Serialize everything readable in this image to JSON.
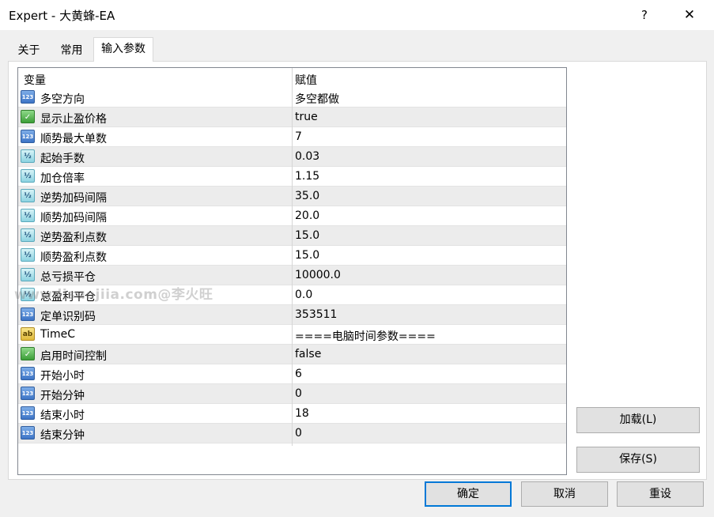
{
  "window": {
    "title": "Expert - 大黄蜂-EA",
    "help": "?",
    "close": "✕"
  },
  "tabs": [
    {
      "label": "关于"
    },
    {
      "label": "常用"
    },
    {
      "label": "输入参数"
    }
  ],
  "grid": {
    "headers": {
      "variable": "变量",
      "value": "赋值"
    },
    "rows": [
      {
        "type": "int",
        "icon": "123",
        "name": "多空方向",
        "value": "多空都做"
      },
      {
        "type": "bool",
        "icon": "✓",
        "name": "显示止盈价格",
        "value": "true"
      },
      {
        "type": "int",
        "icon": "123",
        "name": "顺势最大单数",
        "value": "7"
      },
      {
        "type": "dbl",
        "icon": "½",
        "name": "起始手数",
        "value": "0.03"
      },
      {
        "type": "dbl",
        "icon": "½",
        "name": "加仓倍率",
        "value": "1.15"
      },
      {
        "type": "dbl",
        "icon": "½",
        "name": "逆势加码间隔",
        "value": "35.0"
      },
      {
        "type": "dbl",
        "icon": "½",
        "name": "顺势加码间隔",
        "value": "20.0"
      },
      {
        "type": "dbl",
        "icon": "½",
        "name": "逆势盈利点数",
        "value": "15.0"
      },
      {
        "type": "dbl",
        "icon": "½",
        "name": "顺势盈利点数",
        "value": "15.0"
      },
      {
        "type": "dbl",
        "icon": "½",
        "name": "总亏损平仓",
        "value": "10000.0"
      },
      {
        "type": "dbl",
        "icon": "½",
        "name": "总盈利平仓",
        "value": "0.0"
      },
      {
        "type": "int",
        "icon": "123",
        "name": "定单识别码",
        "value": "353511"
      },
      {
        "type": "str",
        "icon": "ab",
        "name": "TimeC",
        "value": "====电脑时间参数===="
      },
      {
        "type": "bool",
        "icon": "✓",
        "name": "启用时间控制",
        "value": "false"
      },
      {
        "type": "int",
        "icon": "123",
        "name": "开始小时",
        "value": "6"
      },
      {
        "type": "int",
        "icon": "123",
        "name": "开始分钟",
        "value": "0"
      },
      {
        "type": "int",
        "icon": "123",
        "name": "结束小时",
        "value": "18"
      },
      {
        "type": "int",
        "icon": "123",
        "name": "结束分钟",
        "value": "0"
      }
    ]
  },
  "side_buttons": {
    "load": "加载(L)",
    "save": "保存(S)"
  },
  "footer_buttons": {
    "ok": "确定",
    "cancel": "取消",
    "reset": "重设"
  },
  "watermark": "www.lisuojiia.com@李火旺"
}
